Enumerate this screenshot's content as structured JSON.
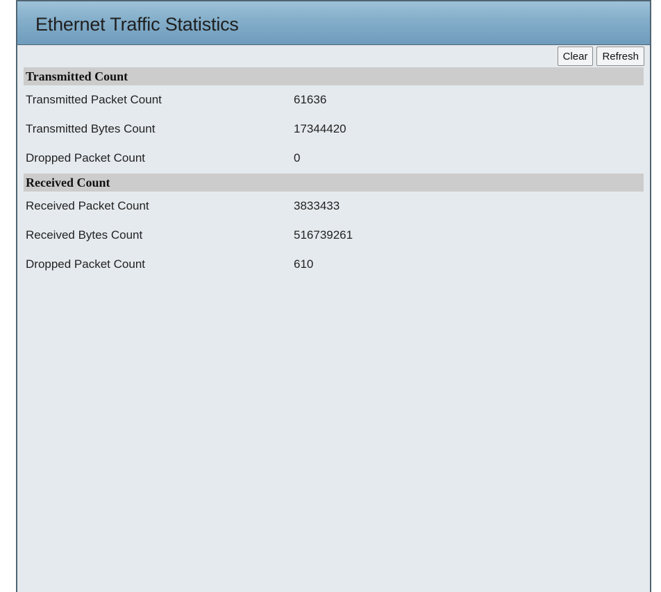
{
  "header": {
    "title": "Ethernet Traffic Statistics"
  },
  "toolbar": {
    "clear_label": "Clear",
    "refresh_label": "Refresh"
  },
  "transmitted": {
    "heading": "Transmitted Count",
    "rows": [
      {
        "label": "Transmitted Packet Count",
        "value": "61636"
      },
      {
        "label": "Transmitted Bytes Count",
        "value": "17344420"
      },
      {
        "label": "Dropped Packet Count",
        "value": "0"
      }
    ]
  },
  "received": {
    "heading": "Received Count",
    "rows": [
      {
        "label": "Received Packet Count",
        "value": "3833433"
      },
      {
        "label": "Received Bytes Count",
        "value": "516739261"
      },
      {
        "label": "Dropped Packet Count",
        "value": "610"
      }
    ]
  }
}
